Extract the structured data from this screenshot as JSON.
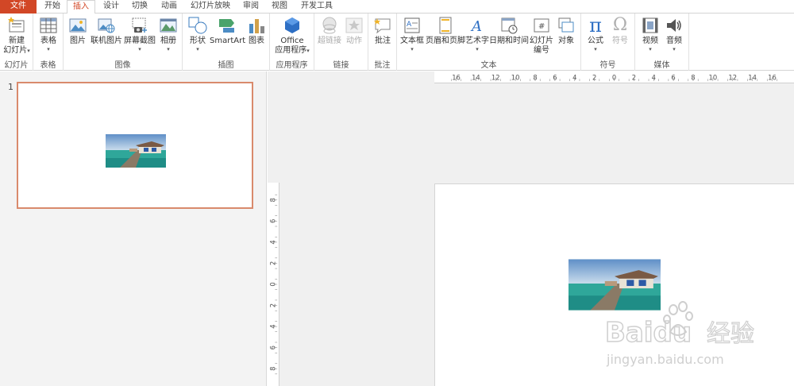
{
  "menu": {
    "tabs": [
      {
        "label": "文件"
      },
      {
        "label": "开始"
      },
      {
        "label": "插入"
      },
      {
        "label": "设计"
      },
      {
        "label": "切换"
      },
      {
        "label": "动画"
      },
      {
        "label": "幻灯片放映"
      },
      {
        "label": "审阅"
      },
      {
        "label": "视图"
      },
      {
        "label": "开发工具"
      }
    ],
    "active_tab": "插入"
  },
  "ribbon": {
    "groups": {
      "slides": {
        "label": "幻灯片",
        "new_slide_l1": "新建",
        "new_slide_l2": "幻灯片"
      },
      "tables": {
        "label": "表格",
        "table": "表格"
      },
      "images": {
        "label": "图像",
        "picture": "图片",
        "online_picture": "联机图片",
        "screenshot": "屏幕截图",
        "album": "相册"
      },
      "illustrations": {
        "label": "插图",
        "shapes": "形状",
        "smartart": "SmartArt",
        "chart": "图表"
      },
      "apps": {
        "label": "应用程序",
        "office_l1": "Office",
        "office_l2": "应用程序"
      },
      "links": {
        "label": "链接",
        "hyperlink": "超链接",
        "action": "动作"
      },
      "comments": {
        "label": "批注",
        "comment": "批注"
      },
      "text": {
        "label": "文本",
        "textbox": "文本框",
        "header_footer": "页眉和页脚",
        "wordart": "艺术字",
        "datetime": "日期和时间",
        "slide_num_l1": "幻灯片",
        "slide_num_l2": "编号",
        "object": "对象"
      },
      "symbols": {
        "label": "符号",
        "equation": "公式",
        "symbol": "符号",
        "pi": "π",
        "omega": "Ω"
      },
      "media": {
        "label": "媒体",
        "video": "视频",
        "audio": "音频"
      }
    }
  },
  "slides_pane": {
    "slide_number": "1"
  },
  "ruler": {
    "horizontal": [
      "16",
      "14",
      "12",
      "10",
      "8",
      "6",
      "4",
      "2",
      "0",
      "2",
      "4",
      "6",
      "8",
      "10",
      "12",
      "14",
      "16"
    ],
    "vertical": [
      "8",
      "6",
      "4",
      "2",
      "0",
      "2",
      "4",
      "6",
      "8"
    ]
  },
  "watermark": {
    "brand": "Baidu",
    "brand_cn": "经验",
    "url": "jingyan.baidu.com"
  },
  "colors": {
    "accent": "#d24726",
    "selection": "#d98a6c"
  }
}
